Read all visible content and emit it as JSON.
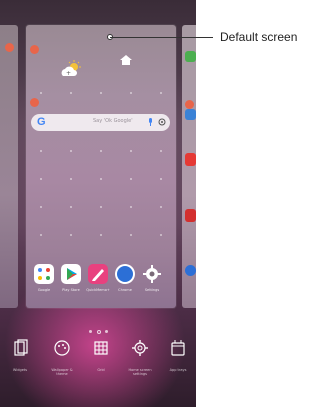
{
  "callout": {
    "label": "Default screen"
  },
  "searchbar": {
    "logo": "G",
    "hint": "Say 'Ok Google'"
  },
  "dock_apps": [
    {
      "label": "Google",
      "icon": "google-folder-icon"
    },
    {
      "label": "Play Store",
      "icon": "play-store-icon"
    },
    {
      "label": "QuickMemo+",
      "icon": "quickmemo-icon"
    },
    {
      "label": "Chrome",
      "icon": "compass-icon"
    },
    {
      "label": "Settings",
      "icon": "settings-icon"
    }
  ],
  "bottom_options": [
    {
      "label": "Widgets",
      "icon": "widgets-icon"
    },
    {
      "label": "Wallpaper & theme",
      "icon": "palette-icon"
    },
    {
      "label": "Grid",
      "icon": "grid-icon"
    },
    {
      "label": "Home screen settings",
      "icon": "gear-icon"
    },
    {
      "label": "App trays",
      "icon": "app-tray-icon"
    }
  ],
  "colors": {
    "remove_badge": "#e8654a",
    "accent_pink": "#da4898"
  }
}
